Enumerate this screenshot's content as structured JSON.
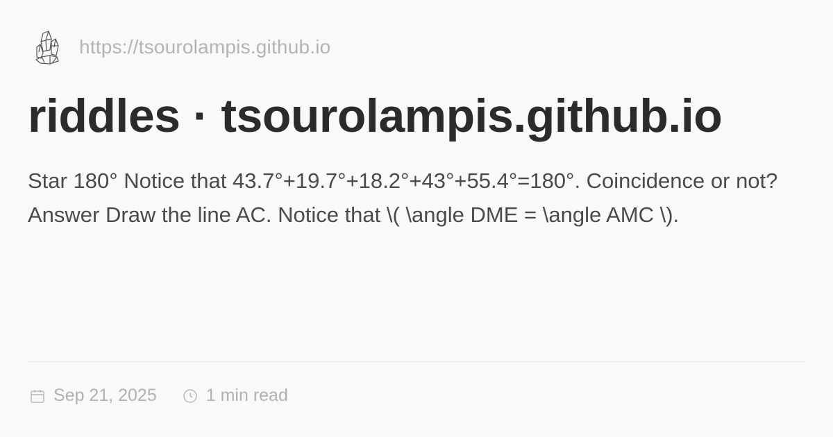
{
  "header": {
    "logo_icon": "crystal-cluster-icon",
    "site_url": "https://tsourolampis.github.io"
  },
  "post": {
    "title": "riddles · tsourolampis.github.io",
    "excerpt": "Star 180° Notice that 43.7°+19.7°+18.2°+43°+55.4°=180°. Coincidence or not? Answer Draw the line AC. Notice that \\( \\angle DME = \\angle AMC \\)."
  },
  "meta": {
    "date_icon": "calendar-icon",
    "date": "Sep 21, 2025",
    "read_time_icon": "clock-icon",
    "read_time": "1 min read"
  },
  "colors": {
    "background": "#f9f9fa",
    "title": "#2b2b2b",
    "body_text": "#4a4a4e",
    "muted_text": "#b0b0b5",
    "divider": "#e6e6e9"
  }
}
